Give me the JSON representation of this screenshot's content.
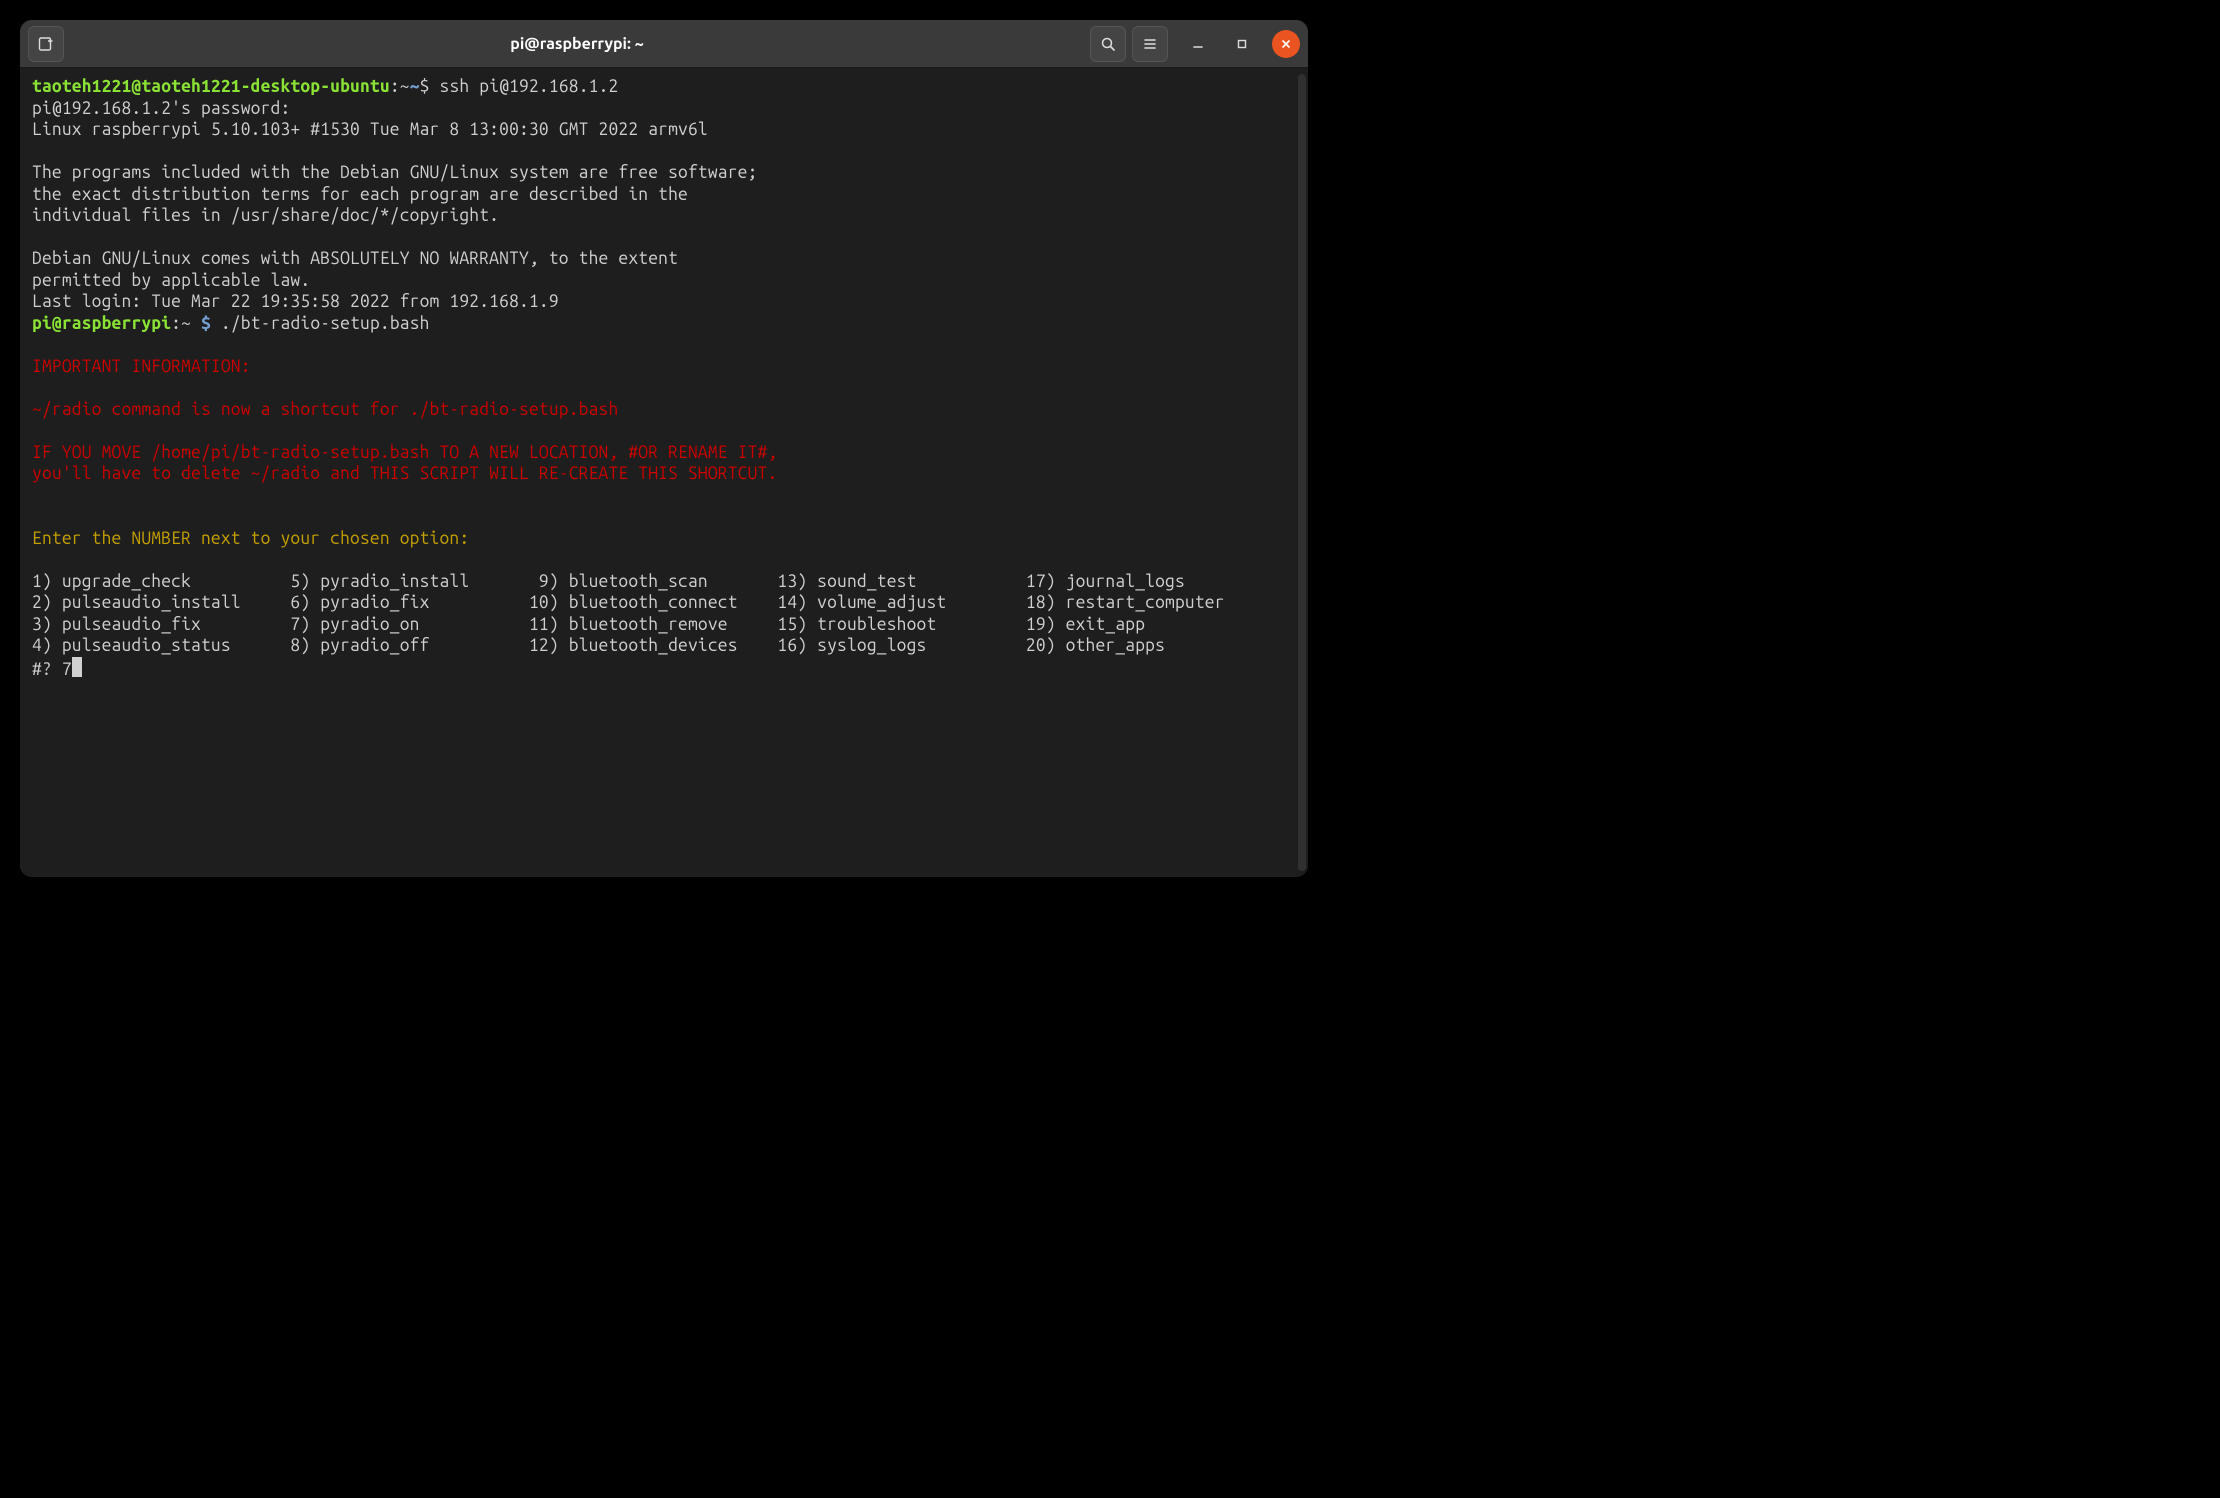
{
  "window": {
    "title": "pi@raspberrypi: ~"
  },
  "prompts": {
    "local_user": "taoteh1221@taoteh1221-desktop-ubuntu",
    "local_path": ":~",
    "local_dollar": "$ ",
    "ssh_cmd": "ssh pi@192.168.1.2",
    "remote_user": "pi@raspberrypi",
    "remote_path": ":~ ",
    "remote_dollar": "$ ",
    "remote_cmd": "./bt-radio-setup.bash"
  },
  "motd": {
    "pwline": "pi@192.168.1.2's password:",
    "kernel": "Linux raspberrypi 5.10.103+ #1530 Tue Mar 8 13:00:30 GMT 2022 armv6l",
    "l1": "The programs included with the Debian GNU/Linux system are free software;",
    "l2": "the exact distribution terms for each program are described in the",
    "l3": "individual files in /usr/share/doc/*/copyright.",
    "l4": "Debian GNU/Linux comes with ABSOLUTELY NO WARRANTY, to the extent",
    "l5": "permitted by applicable law.",
    "lastlogin": "Last login: Tue Mar 22 19:35:58 2022 from 192.168.1.9"
  },
  "script": {
    "hdr": "IMPORTANT INFORMATION:",
    "l1": "~/radio command is now a shortcut for ./bt-radio-setup.bash",
    "l2": "IF YOU MOVE /home/pi/bt-radio-setup.bash TO A NEW LOCATION, #OR RENAME IT#,",
    "l3": "you'll have to delete ~/radio and THIS SCRIPT WILL RE-CREATE THIS SHORTCUT.",
    "choose": "Enter the NUMBER next to your chosen option:",
    "menu_row1": "1) upgrade_check          5) pyradio_install       9) bluetooth_scan       13) sound_test           17) journal_logs",
    "menu_row2": "2) pulseaudio_install     6) pyradio_fix          10) bluetooth_connect    14) volume_adjust        18) restart_computer",
    "menu_row3": "3) pulseaudio_fix         7) pyradio_on           11) bluetooth_remove     15) troubleshoot         19) exit_app",
    "menu_row4": "4) pulseaudio_status      8) pyradio_off          12) bluetooth_devices    16) syslog_logs          20) other_apps",
    "prompt": "#? ",
    "input": "7"
  },
  "menu_options": [
    {
      "n": 1,
      "name": "upgrade_check"
    },
    {
      "n": 2,
      "name": "pulseaudio_install"
    },
    {
      "n": 3,
      "name": "pulseaudio_fix"
    },
    {
      "n": 4,
      "name": "pulseaudio_status"
    },
    {
      "n": 5,
      "name": "pyradio_install"
    },
    {
      "n": 6,
      "name": "pyradio_fix"
    },
    {
      "n": 7,
      "name": "pyradio_on"
    },
    {
      "n": 8,
      "name": "pyradio_off"
    },
    {
      "n": 9,
      "name": "bluetooth_scan"
    },
    {
      "n": 10,
      "name": "bluetooth_connect"
    },
    {
      "n": 11,
      "name": "bluetooth_remove"
    },
    {
      "n": 12,
      "name": "bluetooth_devices"
    },
    {
      "n": 13,
      "name": "sound_test"
    },
    {
      "n": 14,
      "name": "volume_adjust"
    },
    {
      "n": 15,
      "name": "troubleshoot"
    },
    {
      "n": 16,
      "name": "syslog_logs"
    },
    {
      "n": 17,
      "name": "journal_logs"
    },
    {
      "n": 18,
      "name": "restart_computer"
    },
    {
      "n": 19,
      "name": "exit_app"
    },
    {
      "n": 20,
      "name": "other_apps"
    }
  ]
}
